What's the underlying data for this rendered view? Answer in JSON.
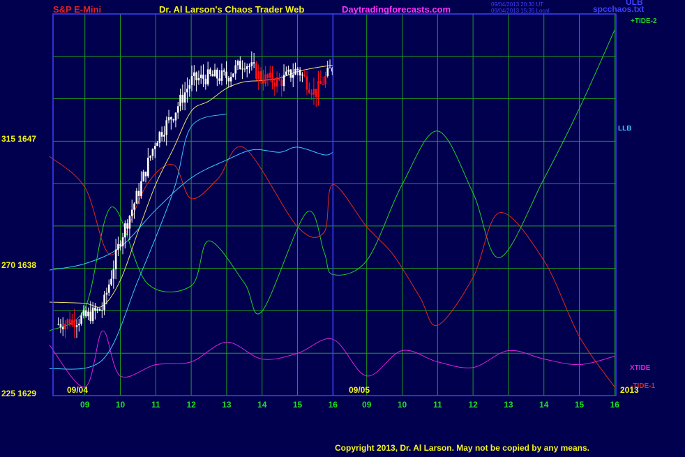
{
  "header": {
    "symbol": "S&P E-Mini",
    "title": "Dr. Al Larson's Chaos Trader Web",
    "site": "Daytradingforecasts.com",
    "timestamp_1": "09/04/2013 20:30 UT",
    "timestamp_2": "09/04/2013 15:35 Local",
    "file": "spcchaos.txt",
    "corner_label": "ULB"
  },
  "footer": {
    "copyright": "Copyright 2013, Dr. Al Larson. May not be copied by any means."
  },
  "colors": {
    "background": "#00004f",
    "grid": "#1e9a1e",
    "frame": "#3f3fff",
    "price_up": "#ffffff",
    "price_down": "#ff1111",
    "tide_plus2": "#22d022",
    "tide_minus1": "#e02a16",
    "xtide": "#dd22dd",
    "llb": "#39c8ff",
    "ulb": "#39c8ff",
    "ma_yellow": "#f0e070"
  },
  "chart_data": {
    "type": "line",
    "title": "S&P E-Mini",
    "xlabel": "",
    "ylabel": "",
    "grid": true,
    "x_ticks": [
      "09",
      "10",
      "11",
      "12",
      "13",
      "14",
      "15",
      "16",
      "09",
      "10",
      "11",
      "12",
      "13",
      "14",
      "15",
      "16"
    ],
    "x_date_labels": [
      "09/04",
      "09/05",
      "2013"
    ],
    "y_scale_labels": [
      "315 1647",
      "270 1638",
      "225 1629"
    ],
    "now_marker": "09/04 16:00",
    "legend": [
      "+TIDE-2",
      "LLB",
      "XTIDE",
      "-TIDE-1",
      "ULB"
    ],
    "price_range": [
      1629,
      1658.8
    ],
    "tide_range": [
      225,
      360.6
    ],
    "price_close_by_hour": {
      "09/04 08:15": 1634.6,
      "09/04 09:00": 1635.1,
      "09/04 09:30": 1635.8,
      "09/04 10:00": 1641.2,
      "09/04 10:30": 1644.8,
      "09/04 11:00": 1649.0,
      "09/04 11:30": 1651.0,
      "09/04 12:00": 1653.6,
      "09/04 12:30": 1653.9,
      "09/04 13:00": 1653.9,
      "09/04 13:30": 1655.1,
      "09/04 14:00": 1653.8,
      "09/04 14:30": 1653.5,
      "09/04 15:00": 1654.5,
      "09/04 15:30": 1652.6,
      "09/04 16:00": 1654.7
    },
    "series": [
      {
        "name": "+TIDE-2",
        "x": [
          "09/04 08:00",
          "09/04 09:00",
          "09/04 09:45",
          "09/04 10:45",
          "09/04 12:00",
          "09/04 12:30",
          "09/04 13:30",
          "09/04 14:00",
          "09/04 15:15",
          "09/04 15:45",
          "09/04 16:00",
          "09/05 09:00",
          "09/05 10:00",
          "09/05 11:00",
          "09/05 12:00",
          "09/05 12:45",
          "09/05 14:00",
          "09/05 15:00",
          "09/05 16:00"
        ],
        "values": [
          248,
          256,
          292,
          265,
          264,
          280,
          265,
          255,
          290,
          276,
          268,
          273,
          300,
          319,
          297,
          274,
          302,
          327,
          355
        ]
      },
      {
        "name": "-TIDE-1",
        "x": [
          "09/04 08:00",
          "09/04 09:00",
          "09/04 09:45",
          "09/04 10:45",
          "09/04 11:30",
          "09/04 12:00",
          "09/04 12:45",
          "09/04 13:30",
          "09/04 15:00",
          "09/04 15:45",
          "09/04 16:00",
          "09/05 09:00",
          "09/05 09:45",
          "09/05 10:30",
          "09/05 11:00",
          "09/05 12:00",
          "09/05 12:45",
          "09/05 14:00",
          "09/05 15:00",
          "09/05 16:00"
        ],
        "values": [
          310,
          299,
          275,
          300,
          307,
          295,
          302,
          313,
          285,
          283,
          300,
          285,
          275,
          260,
          250,
          267,
          290,
          273,
          246,
          228
        ]
      },
      {
        "name": "XTIDE",
        "x": [
          "09/04 08:00",
          "09/04 09:00",
          "09/04 09:30",
          "09/04 10:00",
          "09/04 11:00",
          "09/04 12:00",
          "09/04 13:00",
          "09/04 14:00",
          "09/04 15:00",
          "09/04 16:00",
          "09/05 09:00",
          "09/05 10:00",
          "09/05 11:00",
          "09/05 12:00",
          "09/05 13:00",
          "09/05 14:00",
          "09/05 15:00",
          "09/05 16:00"
        ],
        "values": [
          243,
          228,
          248,
          232,
          236,
          237,
          244,
          238,
          240,
          245,
          232,
          241,
          237,
          235,
          241,
          238,
          236,
          239
        ]
      },
      {
        "name": "LLB",
        "x": [
          "09/04 08:00",
          "09/04 09:00",
          "09/04 10:00",
          "09/04 11:00",
          "09/04 12:00",
          "09/04 13:00",
          "09/04 13:45",
          "09/04 14:30",
          "09/04 15:00",
          "09/04 15:45",
          "09/04 16:00"
        ],
        "values": [
          1638.8,
          1639.3,
          1640.6,
          1643.5,
          1646.0,
          1647.4,
          1648.2,
          1648.0,
          1648.4,
          1647.8,
          1648.0
        ]
      },
      {
        "name": "ULB",
        "x": [
          "09/04 08:00",
          "09/04 09:30",
          "09/04 10:30",
          "09/04 11:30",
          "09/04 12:00",
          "09/04 13:00"
        ],
        "values": [
          1631.1,
          1631.8,
          1638.0,
          1645.0,
          1650.0,
          1651.0
        ]
      },
      {
        "name": "MA",
        "x": [
          "09/04 08:00",
          "09/04 09:00",
          "09/04 09:30",
          "09/04 10:00",
          "09/04 10:30",
          "09/04 11:00",
          "09/04 11:30",
          "09/04 12:00",
          "09/04 12:30",
          "09/04 13:00",
          "09/04 13:30",
          "09/04 14:00",
          "09/04 14:30",
          "09/04 15:00",
          "09/04 15:30",
          "09/04 16:00"
        ],
        "values": [
          1636.3,
          1636.2,
          1636.0,
          1638.0,
          1641.8,
          1645.5,
          1648.3,
          1651.2,
          1652.0,
          1653.0,
          1653.5,
          1653.6,
          1653.8,
          1654.3,
          1654.6,
          1654.8
        ]
      }
    ],
    "annotations": [
      "+TIDE-2",
      "LLB",
      "XTIDE",
      "-TIDE-1",
      "ULB"
    ]
  }
}
